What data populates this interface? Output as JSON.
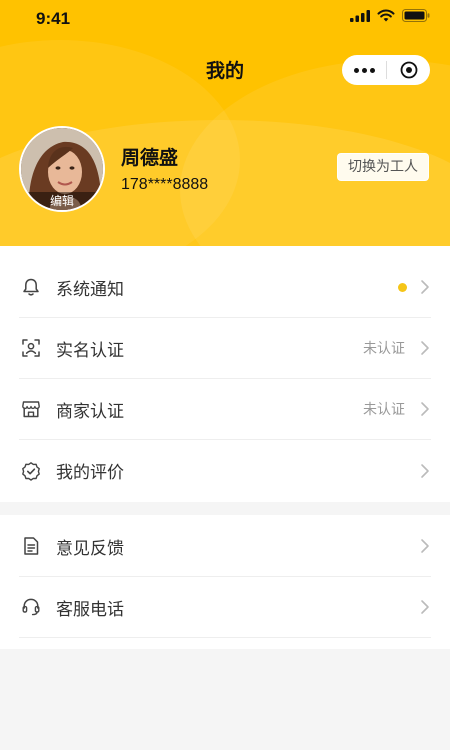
{
  "status_bar": {
    "time": "9:41"
  },
  "nav": {
    "title": "我的"
  },
  "profile": {
    "name": "周德盛",
    "phone": "178****8888",
    "avatar_edit_label": "编辑",
    "switch_label": "切换为工人"
  },
  "menu_group1": [
    {
      "label": "系统通知",
      "icon": "bell-icon",
      "status": "",
      "has_dot": true
    },
    {
      "label": "实名认证",
      "icon": "id-scan-icon",
      "status": "未认证"
    },
    {
      "label": "商家认证",
      "icon": "shop-icon",
      "status": "未认证"
    },
    {
      "label": "我的评价",
      "icon": "badge-check-icon",
      "status": ""
    }
  ],
  "menu_group2": [
    {
      "label": "意见反馈",
      "icon": "document-icon",
      "status": ""
    },
    {
      "label": "客服电话",
      "icon": "headset-icon",
      "status": ""
    }
  ],
  "colors": {
    "brand_yellow": "#ffc200",
    "dot_yellow": "#f5c518",
    "background": "#f5f5f5"
  }
}
